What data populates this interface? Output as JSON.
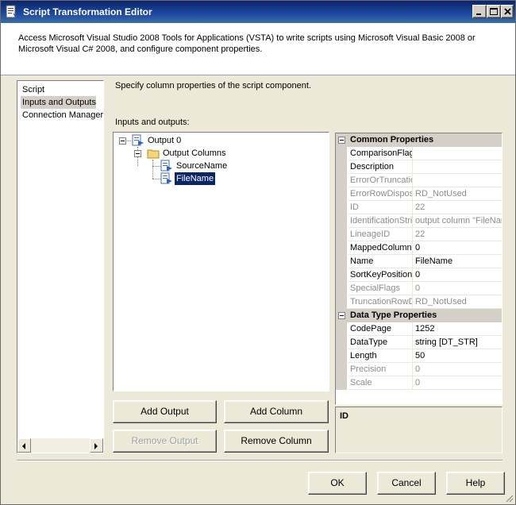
{
  "window": {
    "title": "Script Transformation Editor",
    "header_description": "Access Microsoft Visual Studio 2008 Tools for Applications (VSTA) to write scripts using Microsoft Visual Basic 2008 or Microsoft Visual C# 2008, and configure component properties."
  },
  "nav": {
    "items": [
      {
        "label": "Script",
        "selected": false
      },
      {
        "label": "Inputs and Outputs",
        "selected": true
      },
      {
        "label": "Connection Managers",
        "selected": false
      }
    ]
  },
  "main": {
    "instruction": "Specify column properties of the script component.",
    "io_label": "Inputs and outputs:"
  },
  "tree": {
    "output": "Output 0",
    "output_columns": "Output Columns",
    "columns": [
      "SourceName",
      "FileName"
    ],
    "selected": "FileName"
  },
  "buttons": {
    "add_output": "Add Output",
    "add_column": "Add Column",
    "remove_output": "Remove Output",
    "remove_column": "Remove Column",
    "ok": "OK",
    "cancel": "Cancel",
    "help": "Help"
  },
  "properties": {
    "common_title": "Common Properties",
    "common": [
      {
        "name": "ComparisonFlags",
        "value": "",
        "readonly": false
      },
      {
        "name": "Description",
        "value": "",
        "readonly": false
      },
      {
        "name": "ErrorOrTruncationOperation",
        "value": "",
        "readonly": true
      },
      {
        "name": "ErrorRowDisposition",
        "value": "RD_NotUsed",
        "readonly": true
      },
      {
        "name": "ID",
        "value": "22",
        "readonly": true
      },
      {
        "name": "IdentificationString",
        "value": "output column \"FileName\"",
        "readonly": true
      },
      {
        "name": "LineageID",
        "value": "22",
        "readonly": true
      },
      {
        "name": "MappedColumnID",
        "value": "0",
        "readonly": false
      },
      {
        "name": "Name",
        "value": "FileName",
        "readonly": false
      },
      {
        "name": "SortKeyPosition",
        "value": "0",
        "readonly": false
      },
      {
        "name": "SpecialFlags",
        "value": "0",
        "readonly": true
      },
      {
        "name": "TruncationRowDisposition",
        "value": "RD_NotUsed",
        "readonly": true
      }
    ],
    "datatype_title": "Data Type Properties",
    "datatype": [
      {
        "name": "CodePage",
        "value": "1252",
        "readonly": false
      },
      {
        "name": "DataType",
        "value": "string [DT_STR]",
        "readonly": false
      },
      {
        "name": "Length",
        "value": "50",
        "readonly": false
      },
      {
        "name": "Precision",
        "value": "0",
        "readonly": true
      },
      {
        "name": "Scale",
        "value": "0",
        "readonly": true
      }
    ],
    "description_title": "ID"
  },
  "colors": {
    "titlebar": "#0a246a",
    "selection": "#0a246a",
    "face": "#ece9d8",
    "readonly_text": "#8c8c8c"
  }
}
